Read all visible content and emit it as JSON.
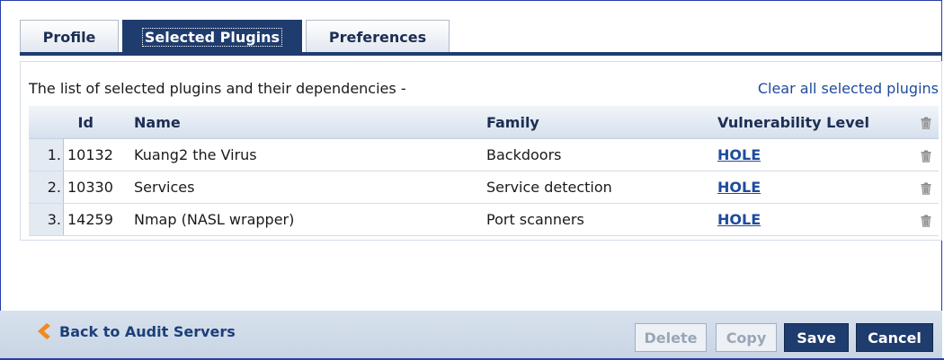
{
  "tabs": [
    {
      "label": "Profile"
    },
    {
      "label": "Selected Plugins"
    },
    {
      "label": "Preferences"
    }
  ],
  "intro_text": "The list of selected plugins and their dependencies -",
  "clear_link": "Clear all selected plugins",
  "table": {
    "headers": {
      "id": "Id",
      "name": "Name",
      "family": "Family",
      "level": "Vulnerability Level"
    },
    "rows": [
      {
        "num": "1.",
        "id": "10132",
        "name": "Kuang2 the Virus",
        "family": "Backdoors",
        "level": "HOLE"
      },
      {
        "num": "2.",
        "id": "10330",
        "name": "Services",
        "family": "Service detection",
        "level": "HOLE"
      },
      {
        "num": "3.",
        "id": "14259",
        "name": "Nmap (NASL wrapper)",
        "family": "Port scanners",
        "level": "HOLE"
      }
    ]
  },
  "footer": {
    "back_label": "Back to Audit Servers",
    "delete_label": "Delete",
    "copy_label": "Copy",
    "save_label": "Save",
    "cancel_label": "Cancel"
  },
  "icons": {
    "back": "chevron-left-icon",
    "trash": "trash-icon"
  },
  "colors": {
    "accent": "#1f3c6e",
    "link": "#1e4b9e",
    "back_arrow": "#f08a1c",
    "frame": "#2a3ea8"
  }
}
